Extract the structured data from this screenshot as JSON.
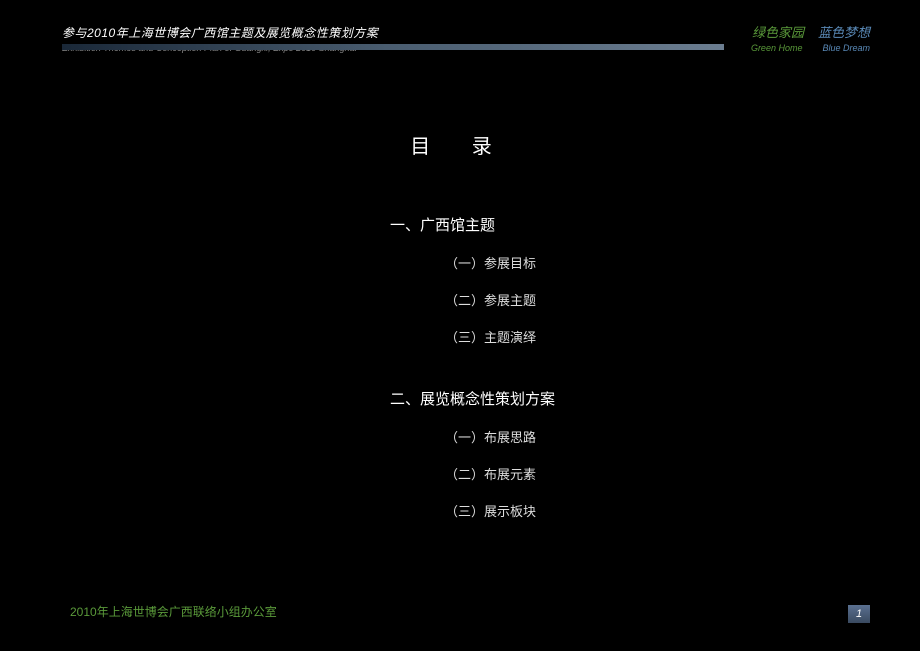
{
  "header": {
    "title_cn": "参与2010年上海世博会广西馆主题及展览概念性策划方案",
    "title_en": "Exhibition Themes and Conception Plan of Guangxi, Expo 2010 Shanghai",
    "slogan_green_cn": "绿色家园",
    "slogan_blue_cn": "蓝色梦想",
    "slogan_green_en": "Green Home",
    "slogan_blue_en": "Blue Dream"
  },
  "toc": {
    "title": "目 录",
    "sections": [
      {
        "heading": "一、广西馆主题",
        "items": [
          "（一）参展目标",
          "（二）参展主题",
          "（三）主题演绎"
        ]
      },
      {
        "heading": "二、展览概念性策划方案",
        "items": [
          "（一）布展思路",
          "（二）布展元素",
          "（三）展示板块"
        ]
      }
    ]
  },
  "footer": {
    "org": "2010年上海世博会广西联络小组办公室",
    "page": "1"
  }
}
